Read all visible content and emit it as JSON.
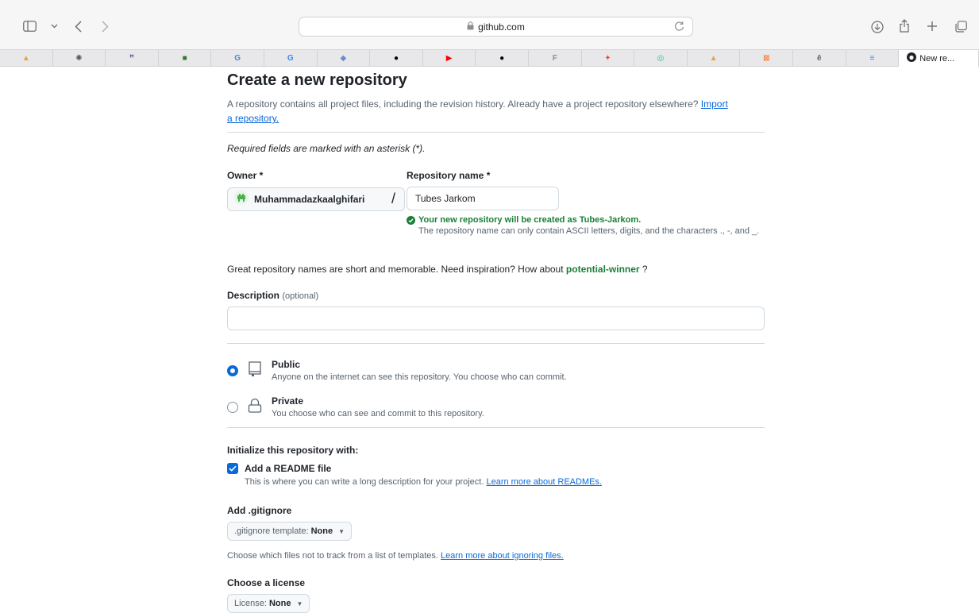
{
  "browser": {
    "url": "github.com",
    "active_tab_title": "New re...",
    "tab_favicons": [
      {
        "icon": "aws-stack-icon",
        "color": "#e8a33d",
        "glyph": "▲"
      },
      {
        "icon": "openai-icon",
        "color": "#555555",
        "glyph": "✺"
      },
      {
        "icon": "teams-icon",
        "color": "#6264a7",
        "glyph": "ꟸ"
      },
      {
        "icon": "app-green-icon",
        "color": "#2e7d32",
        "glyph": "■"
      },
      {
        "icon": "google-icon",
        "color": "#4285f4",
        "glyph": "G"
      },
      {
        "icon": "google-icon",
        "color": "#4285f4",
        "glyph": "G"
      },
      {
        "icon": "shield-icon",
        "color": "#6b8cc7",
        "glyph": "◆"
      },
      {
        "icon": "github-icon",
        "color": "#000000",
        "glyph": "●"
      },
      {
        "icon": "youtube-icon",
        "color": "#ff0000",
        "glyph": "▶"
      },
      {
        "icon": "github-icon",
        "color": "#000000",
        "glyph": "●"
      },
      {
        "icon": "app-gray-icon",
        "color": "#8e8e93",
        "glyph": "F"
      },
      {
        "icon": "figma-icon",
        "color": "#f24e1e",
        "glyph": "✦"
      },
      {
        "icon": "drive-app-icon",
        "color": "#1bc9a0",
        "glyph": "◎"
      },
      {
        "icon": "aws-stack-icon",
        "color": "#e8a33d",
        "glyph": "▲"
      },
      {
        "icon": "xampp-icon",
        "color": "#fb7a24",
        "glyph": "⊠"
      },
      {
        "icon": "epub-icon",
        "color": "#666666",
        "glyph": "ē"
      },
      {
        "icon": "docs-icon",
        "color": "#4285f4",
        "glyph": "≡"
      }
    ]
  },
  "page": {
    "title": "Create a new repository",
    "lead": "A repository contains all project files, including the revision history. Already have a project repository elsewhere?",
    "import_link": "Import a repository.",
    "required_note": "Required fields are marked with an asterisk (*).",
    "owner_label": "Owner *",
    "owner_name": "Muhammadazkaalghifari",
    "slash": "/",
    "repo_label": "Repository name *",
    "repo_value": "Tubes Jarkom",
    "valid_message": "Your new repository will be created as Tubes-Jarkom.",
    "valid_note": "The repository name can only contain ASCII letters, digits, and the characters ., -, and _.",
    "suggest_prefix": "Great repository names are short and memorable. Need inspiration? How about",
    "suggest_name": "potential-winner",
    "suggest_suffix": "?",
    "description_label": "Description",
    "description_optional": "(optional)",
    "description_value": "",
    "visibility": [
      {
        "title": "Public",
        "desc": "Anyone on the internet can see this repository. You choose who can commit.",
        "selected": true
      },
      {
        "title": "Private",
        "desc": "You choose who can see and commit to this repository.",
        "selected": false
      }
    ],
    "init_heading": "Initialize this repository with:",
    "readme_label": "Add a README file",
    "readme_checked": true,
    "readme_desc": "This is where you can write a long description for your project.",
    "readme_link": "Learn more about READMEs.",
    "gitignore_heading": "Add .gitignore",
    "gitignore_dropdown_prefix": ".gitignore template:",
    "gitignore_dropdown_value": "None",
    "gitignore_help": "Choose which files not to track from a list of templates.",
    "gitignore_link": "Learn more about ignoring files.",
    "license_heading": "Choose a license",
    "license_dropdown_prefix": "License:",
    "license_dropdown_value": "None"
  },
  "colors": {
    "accent": "#0969da",
    "success": "#1a7f37",
    "border": "#d1d9e0"
  }
}
